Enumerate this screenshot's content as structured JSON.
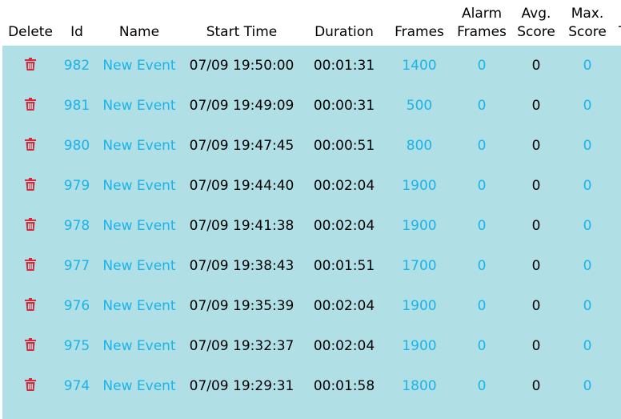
{
  "columns": {
    "delete": "Delete",
    "id": "Id",
    "name": "Name",
    "start_time": "Start Time",
    "duration": "Duration",
    "frames": "Frames",
    "alarm_frames_1": "Alarm",
    "alarm_frames_2": "Frames",
    "avg_score_1": "Avg.",
    "avg_score_2": "Score",
    "max_score_1": "Max.",
    "max_score_2": "Score",
    "extra": "T"
  },
  "colors": {
    "accent_link": "#1ab3ea",
    "row_bg": "#b0e0e6",
    "delete_icon": "#d22b3c"
  },
  "events": [
    {
      "id": "982",
      "name": "New Event",
      "start": "07/09 19:50:00",
      "duration": "00:01:31",
      "frames": "1400",
      "alarm": "0",
      "avg": "0",
      "max": "0"
    },
    {
      "id": "981",
      "name": "New Event",
      "start": "07/09 19:49:09",
      "duration": "00:00:31",
      "frames": "500",
      "alarm": "0",
      "avg": "0",
      "max": "0"
    },
    {
      "id": "980",
      "name": "New Event",
      "start": "07/09 19:47:45",
      "duration": "00:00:51",
      "frames": "800",
      "alarm": "0",
      "avg": "0",
      "max": "0"
    },
    {
      "id": "979",
      "name": "New Event",
      "start": "07/09 19:44:40",
      "duration": "00:02:04",
      "frames": "1900",
      "alarm": "0",
      "avg": "0",
      "max": "0"
    },
    {
      "id": "978",
      "name": "New Event",
      "start": "07/09 19:41:38",
      "duration": "00:02:04",
      "frames": "1900",
      "alarm": "0",
      "avg": "0",
      "max": "0"
    },
    {
      "id": "977",
      "name": "New Event",
      "start": "07/09 19:38:43",
      "duration": "00:01:51",
      "frames": "1700",
      "alarm": "0",
      "avg": "0",
      "max": "0"
    },
    {
      "id": "976",
      "name": "New Event",
      "start": "07/09 19:35:39",
      "duration": "00:02:04",
      "frames": "1900",
      "alarm": "0",
      "avg": "0",
      "max": "0"
    },
    {
      "id": "975",
      "name": "New Event",
      "start": "07/09 19:32:37",
      "duration": "00:02:04",
      "frames": "1900",
      "alarm": "0",
      "avg": "0",
      "max": "0"
    },
    {
      "id": "974",
      "name": "New Event",
      "start": "07/09 19:29:31",
      "duration": "00:01:58",
      "frames": "1800",
      "alarm": "0",
      "avg": "0",
      "max": "0"
    }
  ]
}
